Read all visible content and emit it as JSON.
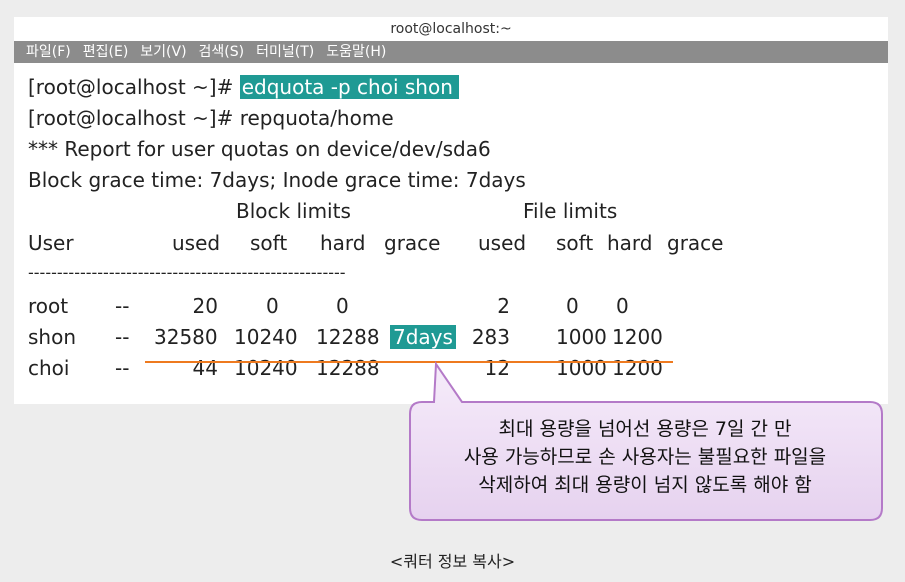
{
  "window": {
    "title": "root@localhost:~",
    "menu": [
      "파일(F)",
      "편집(E)",
      "보기(V)",
      "검색(S)",
      "터미널(T)",
      "도움말(H)"
    ]
  },
  "terminal": {
    "line1_prompt": "[root@localhost ~]#",
    "line1_cmd": "edquota -p choi shon",
    "line2": "[root@localhost ~]# repquota/home",
    "line3": "*** Report for user quotas on device/dev/sda6",
    "line4": "Block grace time: 7days; Inode grace time: 7days",
    "block_limits": "Block limits",
    "file_limits": "File limits",
    "headers": {
      "user": "User",
      "used": "used",
      "soft": "soft",
      "hard": "hard",
      "grace": "grace",
      "fused": "used",
      "fsoft": "soft",
      "fhard": "hard",
      "fgrace": "grace"
    },
    "separator": "-------------------------------------------------------",
    "rows": [
      {
        "user": "root",
        "flag": "--",
        "used": "20",
        "soft": "0",
        "hard": "0",
        "grace": "",
        "fused": "2",
        "fsoft": "0",
        "fhard": "0"
      },
      {
        "user": "shon",
        "flag": "--",
        "used": "32580",
        "soft": "10240",
        "hard": "12288",
        "grace": "7days",
        "fused": "283",
        "fsoft": "1000",
        "fhard": "1200"
      },
      {
        "user": "choi",
        "flag": "--",
        "used": "44",
        "soft": "10240",
        "hard": "12288",
        "grace": "",
        "fused": "12",
        "fsoft": "1000",
        "fhard": "1200"
      }
    ]
  },
  "callout": {
    "line1": "최대 용량을 넘어선 용량은 7일 간 만",
    "line2": "사용 가능하므로 손 사용자는 불필요한 파일을",
    "line3": "삭제하여 최대 용량이 넘지 않도록 해야 함"
  },
  "caption": "<쿼터 정보 복사>",
  "colors": {
    "highlight": "#1f9a94",
    "underline": "#ee7a1f",
    "callout_fill": "#efe0f5",
    "callout_border": "#b47ac8",
    "menubar": "#8c8c8c"
  }
}
